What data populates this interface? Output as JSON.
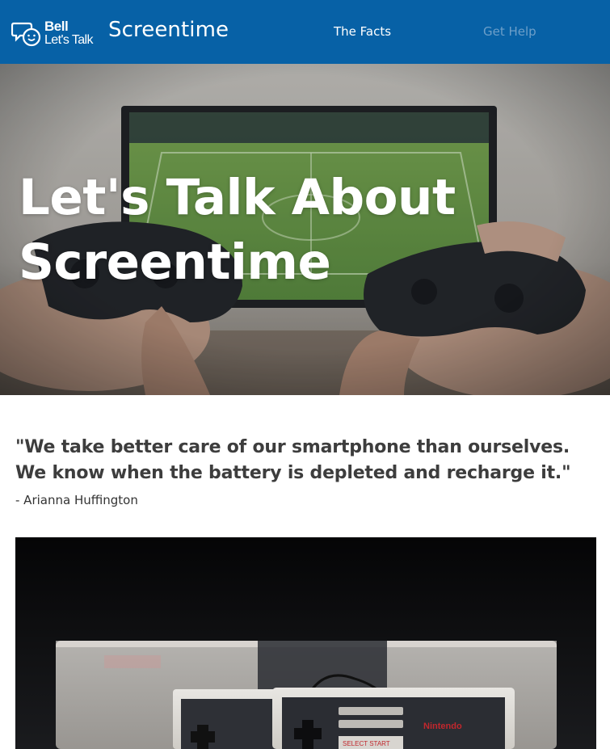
{
  "header": {
    "logo": {
      "line1": "Bell",
      "line2": "Let's Talk"
    },
    "brand": "Screentime",
    "nav": [
      {
        "label": "The Facts"
      },
      {
        "label": "Get Help"
      }
    ]
  },
  "hero": {
    "title": "Let's Talk About Screentime"
  },
  "quote": {
    "text": "\"We take better care of our smartphone than ourselves. We know when the battery is depleted and recharge it.\"",
    "attribution": "- Arianna Huffington"
  },
  "photo": {
    "console_text": {
      "brand": "Nintendo",
      "select_start": "SELECT START"
    }
  }
}
